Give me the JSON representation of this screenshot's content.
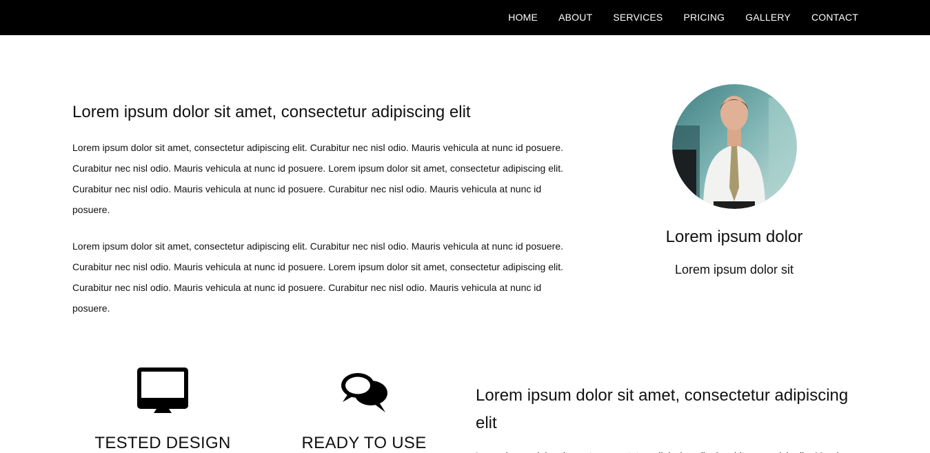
{
  "nav": {
    "items": [
      "HOME",
      "ABOUT",
      "SERVICES",
      "PRICING",
      "GALLERY",
      "CONTACT"
    ]
  },
  "intro": {
    "heading": "Lorem ipsum dolor sit amet, consectetur adipiscing elit",
    "paragraph1": "Lorem ipsum dolor sit amet, consectetur adipiscing elit. Curabitur nec nisl odio. Mauris vehicula at nunc id posuere. Curabitur nec nisl odio. Mauris vehicula at nunc id posuere. Lorem ipsum dolor sit amet, consectetur adipiscing elit. Curabitur nec nisl odio. Mauris vehicula at nunc id posuere. Curabitur nec nisl odio. Mauris vehicula at nunc id posuere.",
    "paragraph2": "Lorem ipsum dolor sit amet, consectetur adipiscing elit. Curabitur nec nisl odio. Mauris vehicula at nunc id posuere. Curabitur nec nisl odio. Mauris vehicula at nunc id posuere. Lorem ipsum dolor sit amet, consectetur adipiscing elit. Curabitur nec nisl odio. Mauris vehicula at nunc id posuere. Curabitur nec nisl odio. Mauris vehicula at nunc id posuere."
  },
  "profile": {
    "name": "Lorem ipsum dolor",
    "role": "Lorem ipsum dolor sit"
  },
  "features": [
    {
      "icon": "monitor-icon",
      "label": "TESTED DESIGN"
    },
    {
      "icon": "chat-bubbles-icon",
      "label": "READY TO USE"
    }
  ],
  "aside": {
    "heading": "Lorem ipsum dolor sit amet, consectetur adipiscing elit",
    "paragraph": "Lorem ipsum dolor sit amet, consectetur adipiscing elit. Curabitur nec nisl odio. Mauris"
  },
  "colors": {
    "nav_background": "#000000",
    "nav_text": "#ffffff",
    "text": "#111111"
  }
}
